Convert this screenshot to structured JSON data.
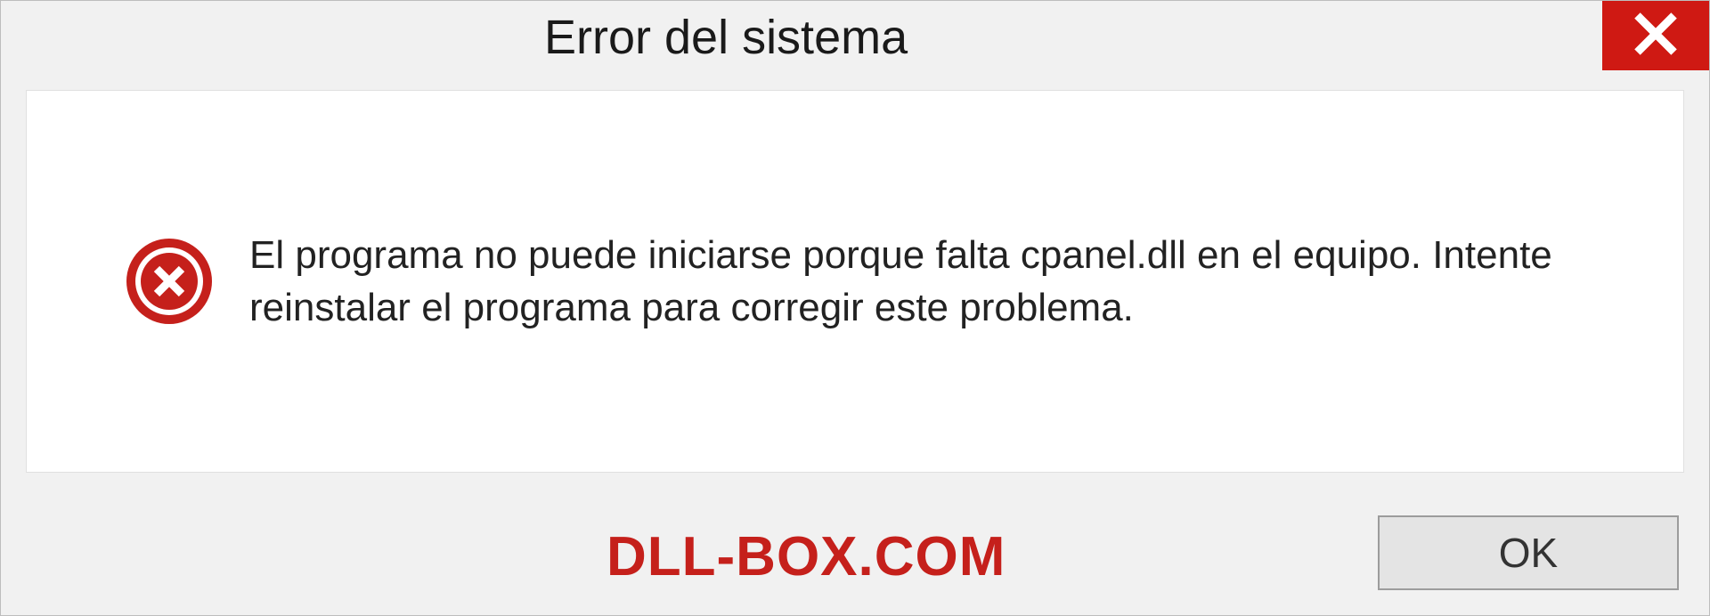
{
  "dialog": {
    "title": "Error del sistema",
    "message": "El programa no puede iniciarse porque falta cpanel.dll en el equipo. Intente reinstalar el programa para corregir este problema.",
    "ok_label": "OK"
  },
  "watermark": "DLL-BOX.COM",
  "colors": {
    "close_bg": "#cf1913",
    "error_icon": "#c5201b",
    "watermark": "#c5201b"
  }
}
